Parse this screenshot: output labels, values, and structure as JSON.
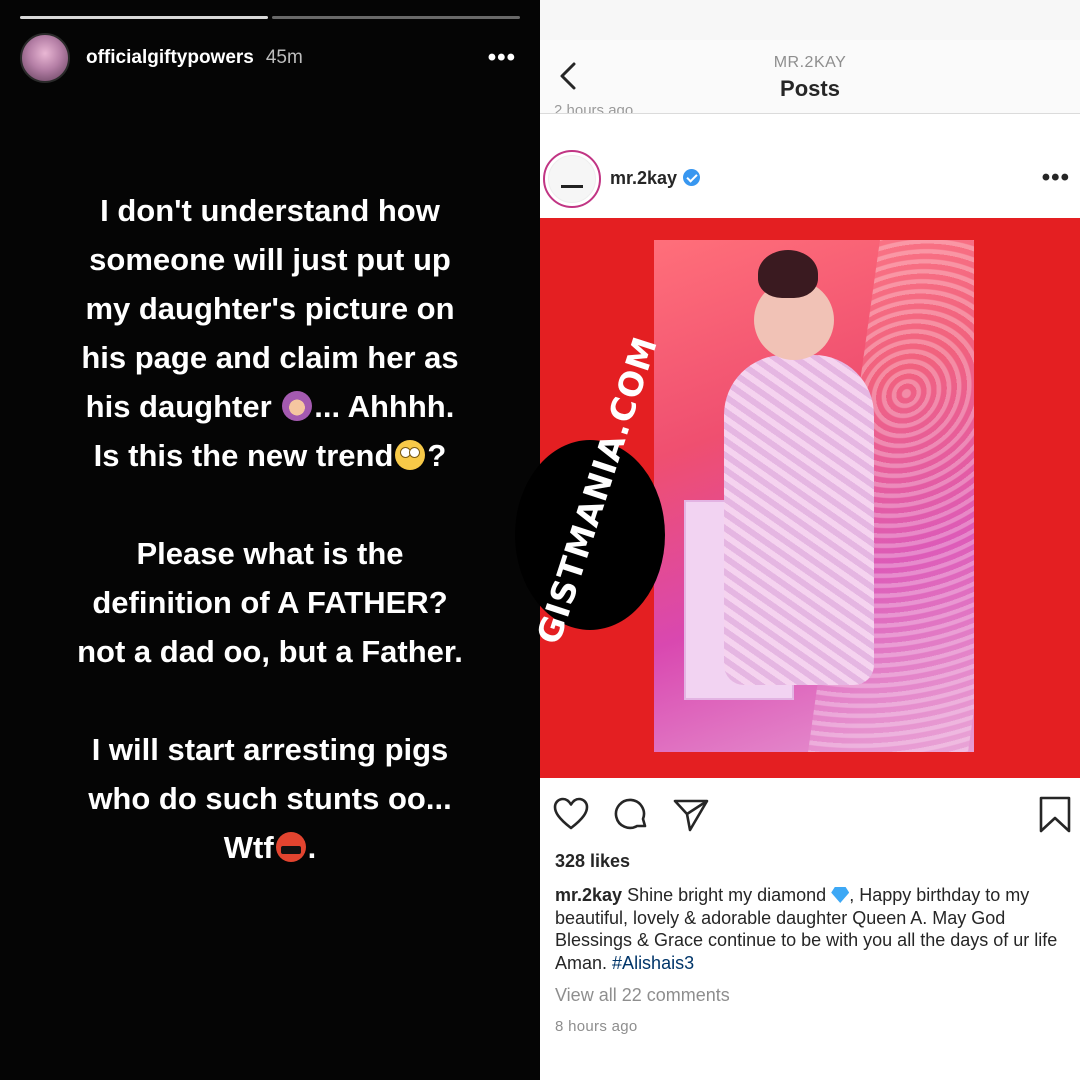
{
  "story": {
    "username": "officialgiftypowers",
    "time": "45m",
    "more": "•••",
    "para1": [
      "I don't understand how",
      "someone will just put up",
      "my daughter's picture on",
      "his page and claim her as",
      "his daughter",
      "... Ahhhh.",
      "Is this the new trend",
      "?"
    ],
    "para2": [
      "Please what is the",
      "definition of A FATHER?",
      "not a dad oo, but a Father."
    ],
    "para3": [
      "I will start arresting pigs",
      "who do such stunts oo...",
      "Wtf",
      "."
    ],
    "icons": [
      "woman-facepalming-emoji",
      "face-with-rolling-eyes-emoji",
      "face-with-symbols-over-mouth-emoji"
    ]
  },
  "instagram": {
    "header_username": "MR.2KAY",
    "header_title": "Posts",
    "cut_timestamp": "2 hours ago",
    "post_username": "mr.2kay",
    "more": "•••",
    "likes": "328 likes",
    "caption_user": "mr.2kay",
    "caption_part1": "Shine bright my diamond",
    "caption_part2": ", Happy birthday to my beautiful, lovely & adorable daughter Queen A. May God Blessings & Grace continue to be with you all the days of ur life Aman.",
    "caption_hashtag": "#Alishais3",
    "view_comments": "View all 22 comments",
    "time_ago": "8 hours ago",
    "colors": {
      "image_background": "#e41f22",
      "verified": "#3897f0",
      "hashtag": "#003569"
    }
  },
  "watermark": {
    "text": "GISTMANIA.COM"
  }
}
